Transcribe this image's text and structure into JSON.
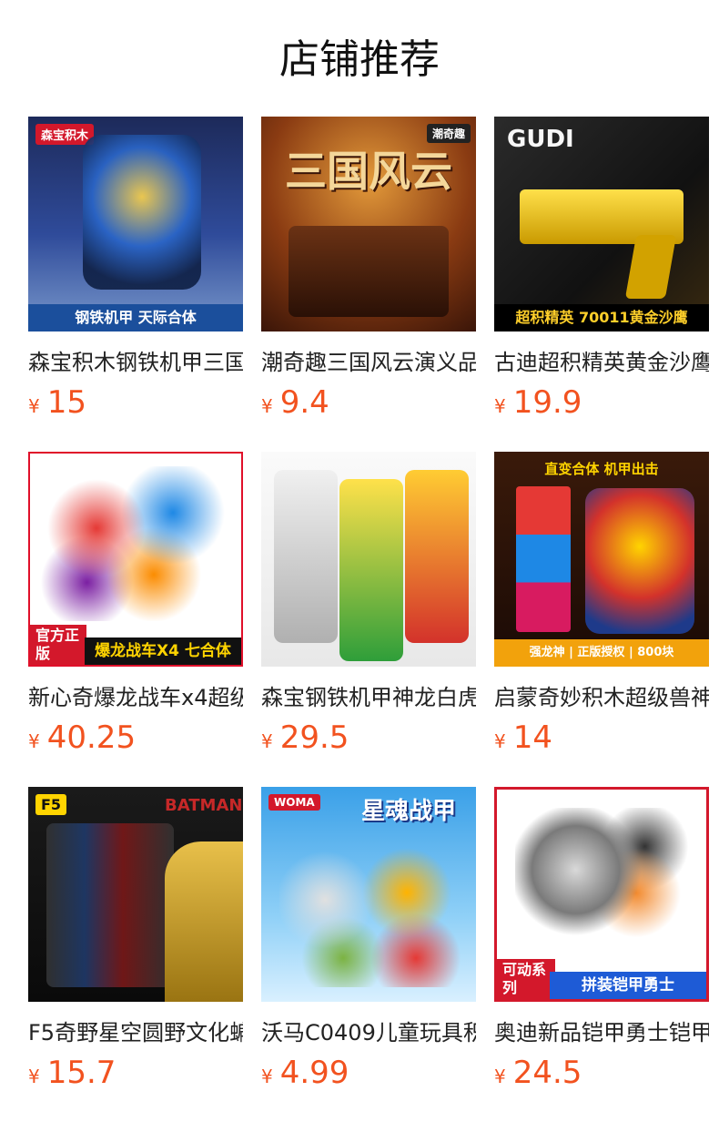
{
  "page_title": "店铺推荐",
  "currency_symbol": "¥",
  "products": [
    {
      "name": "森宝积木钢铁机甲三国",
      "price": "15",
      "image_text": "钢铁机甲 天际合体",
      "badge": "森宝积木"
    },
    {
      "name": "潮奇趣三国风云演义品",
      "price": "9.4",
      "image_text": "三国风云",
      "badge": "潮奇趣"
    },
    {
      "name": "古迪超积精英黄金沙鹰",
      "price": "19.9",
      "image_text": "超积精英 70011黄金沙鹰",
      "badge": "GUDI"
    },
    {
      "name": "新心奇爆龙战车x4超级",
      "price": "40.25",
      "image_text": "爆龙战车X4 七合体",
      "badge": "官方正版"
    },
    {
      "name": "森宝钢铁机甲神龙白虎",
      "price": "29.5",
      "image_text": "",
      "badge": ""
    },
    {
      "name": "启蒙奇妙积木超级兽神",
      "price": "14",
      "image_text": "强龙神 | 正版授权 | 800块",
      "badge": "直变合体 机甲出击"
    },
    {
      "name": "F5奇野星空圆野文化蝙",
      "price": "15.7",
      "image_text": "BATMAN",
      "badge": "F5"
    },
    {
      "name": "沃马C0409儿童玩具积",
      "price": "4.99",
      "image_text": "星魂战甲",
      "badge": "WOMA"
    },
    {
      "name": "奥迪新品铠甲勇士铠甲",
      "price": "24.5",
      "image_text": "拼装铠甲勇士",
      "badge": "可动系列"
    }
  ],
  "colors": {
    "price": "#f2521f",
    "title": "#111111"
  }
}
